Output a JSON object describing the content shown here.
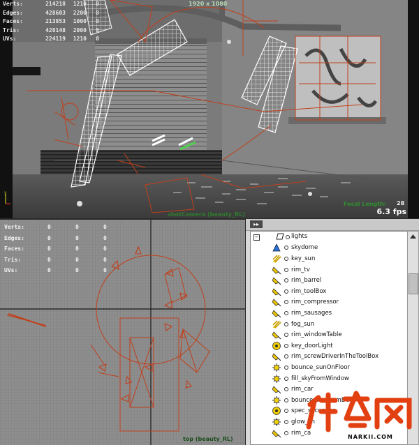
{
  "perspective_view": {
    "resolution": "1920 x 1080",
    "stats": [
      {
        "label": "Verts:",
        "a": "214218",
        "b": "1210",
        "c": "0"
      },
      {
        "label": "Edges:",
        "a": "428603",
        "b": "2200",
        "c": "0"
      },
      {
        "label": "Faces:",
        "a": "213853",
        "b": "1000",
        "c": "0"
      },
      {
        "label": "Tris:",
        "a": "428148",
        "b": "2000",
        "c": "0"
      },
      {
        "label": "UVs:",
        "a": "224119",
        "b": "1210",
        "c": "0"
      }
    ],
    "focal_label": "Focal Length:",
    "focal_value": "28",
    "fps": "6.3 fps",
    "camera_label": "shotCamera (beauty_RL)"
  },
  "top_view": {
    "stats": [
      {
        "label": "Verts:",
        "a": "0",
        "b": "0",
        "c": "0"
      },
      {
        "label": "Edges:",
        "a": "0",
        "b": "0",
        "c": "0"
      },
      {
        "label": "Faces:",
        "a": "0",
        "b": "0",
        "c": "0"
      },
      {
        "label": "Tris:",
        "a": "0",
        "b": "0",
        "c": "0"
      },
      {
        "label": "UVs:",
        "a": "0",
        "b": "0",
        "c": "0"
      }
    ],
    "camera_label": "top (beauty_RL)"
  },
  "outliner": {
    "group": "lights",
    "expand_symbol": "−",
    "items": [
      {
        "name": "skydome",
        "icon": "sky-dome-icon"
      },
      {
        "name": "key_sun",
        "icon": "directional-light-icon"
      },
      {
        "name": "rim_tv",
        "icon": "spot-light-icon"
      },
      {
        "name": "rim_barrel",
        "icon": "spot-light-icon"
      },
      {
        "name": "rim_toolBox",
        "icon": "spot-light-icon"
      },
      {
        "name": "rim_compressor",
        "icon": "spot-light-icon"
      },
      {
        "name": "rim_sausages",
        "icon": "spot-light-icon"
      },
      {
        "name": "fog_sun",
        "icon": "directional-light-icon"
      },
      {
        "name": "rim_windowTable",
        "icon": "spot-light-icon"
      },
      {
        "name": "key_doorLight",
        "icon": "point-light-icon"
      },
      {
        "name": "rim_screwDriverInTheToolBox",
        "icon": "spot-light-icon"
      },
      {
        "name": "bounce_sunOnFloor",
        "icon": "area-light-icon"
      },
      {
        "name": "fill_skyFromWindow",
        "icon": "area-light-icon"
      },
      {
        "name": "rim_car",
        "icon": "spot-light-icon"
      },
      {
        "name": "bounce_sunFromDoor",
        "icon": "area-light-icon"
      },
      {
        "name": "spec_secondar",
        "icon": "point-light-icon"
      },
      {
        "name": "glow_sh",
        "icon": "area-light-icon"
      },
      {
        "name": "rim_ca",
        "icon": "spot-light-icon"
      }
    ]
  },
  "watermark": {
    "text": "NARKII.COM"
  },
  "colors": {
    "gizmo": "#c0401c",
    "wire": "#ffffff",
    "grid_major": "#1a1a1a"
  }
}
